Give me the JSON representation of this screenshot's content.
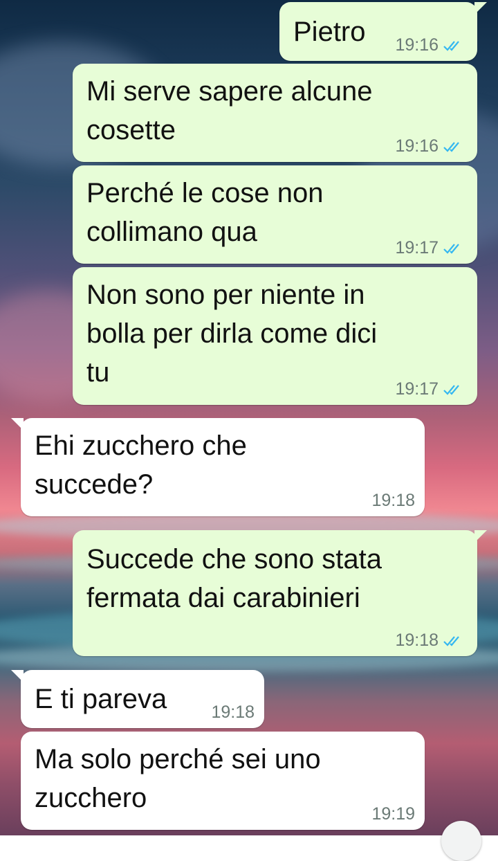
{
  "messages": [
    {
      "text": "Pietro",
      "time": "19:16"
    },
    {
      "text": "Mi serve sapere alcune\ncosette",
      "time": "19:16"
    },
    {
      "text": "Perché le cose non\ncollimano qua",
      "time": "19:17"
    },
    {
      "text": "Non sono per niente in\nbolla per dirla come dici\ntu",
      "time": "19:17"
    },
    {
      "text": "Ehi zucchero che\nsuccede?",
      "time": "19:18"
    },
    {
      "text": "Succede che sono stata\nfermata dai carabinieri",
      "time": "19:18"
    },
    {
      "text": "E ti pareva",
      "time": "19:18"
    },
    {
      "text": "Ma solo perché sei uno\nzucchero",
      "time": "19:19"
    }
  ],
  "colors": {
    "outgoing_bubble": "#e7fdd7",
    "incoming_bubble": "#ffffff",
    "read_ticks": "#34b7f1"
  },
  "icons": {
    "read_receipt": "double-check-icon",
    "scroll": "scroll-down-icon"
  }
}
